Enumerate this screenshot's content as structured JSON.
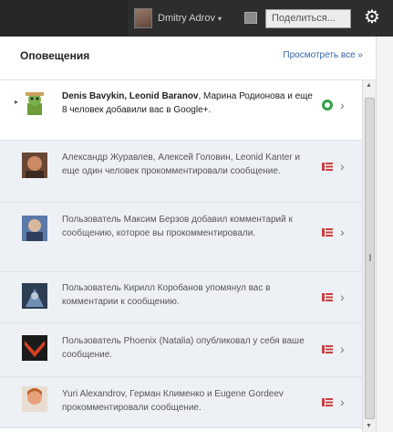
{
  "topbar": {
    "user_name": "Dmitry Adrov",
    "caret": "▾",
    "share_label": "Поделиться...",
    "gear": "⚙"
  },
  "panel": {
    "title": "Оповещения",
    "view_all": "Просмотреть все »"
  },
  "notifications": [
    {
      "bold": "Denis Bavykin, Leonid Baranov",
      "text": ", Марина Родионова и еще 8 человек добавили вас в Google+.",
      "icon": "circle-add-icon",
      "unread": true
    },
    {
      "text": "Александр Журавлев, Алексей Головин, Leonid Kanter и еще один человек прокомментировали сообщение.",
      "icon": "comment-icon"
    },
    {
      "text": "Пользователь Максим Берзов добавил комментарий к сообщению, которое вы прокомментировали.",
      "icon": "comment-icon"
    },
    {
      "text": "Пользователь Кирилл Коробанов упомянул вас в комментарии к сообщению.",
      "icon": "comment-icon"
    },
    {
      "text": "Пользователь Phoenix (Natalia) опубликовал у себя ваше сообщение.",
      "icon": "comment-icon"
    },
    {
      "text": "Yuri Alexandrov, Герман Клименко и Eugene Gordeev прокомментировали сообщение.",
      "icon": "comment-icon"
    }
  ],
  "chevron": "›",
  "colors": {
    "topbar": "#2d2d2d",
    "link": "#3366aa",
    "read_bg": "#edf1f5",
    "added_icon": "#2fa24a",
    "comment_icon": "#c94040"
  }
}
